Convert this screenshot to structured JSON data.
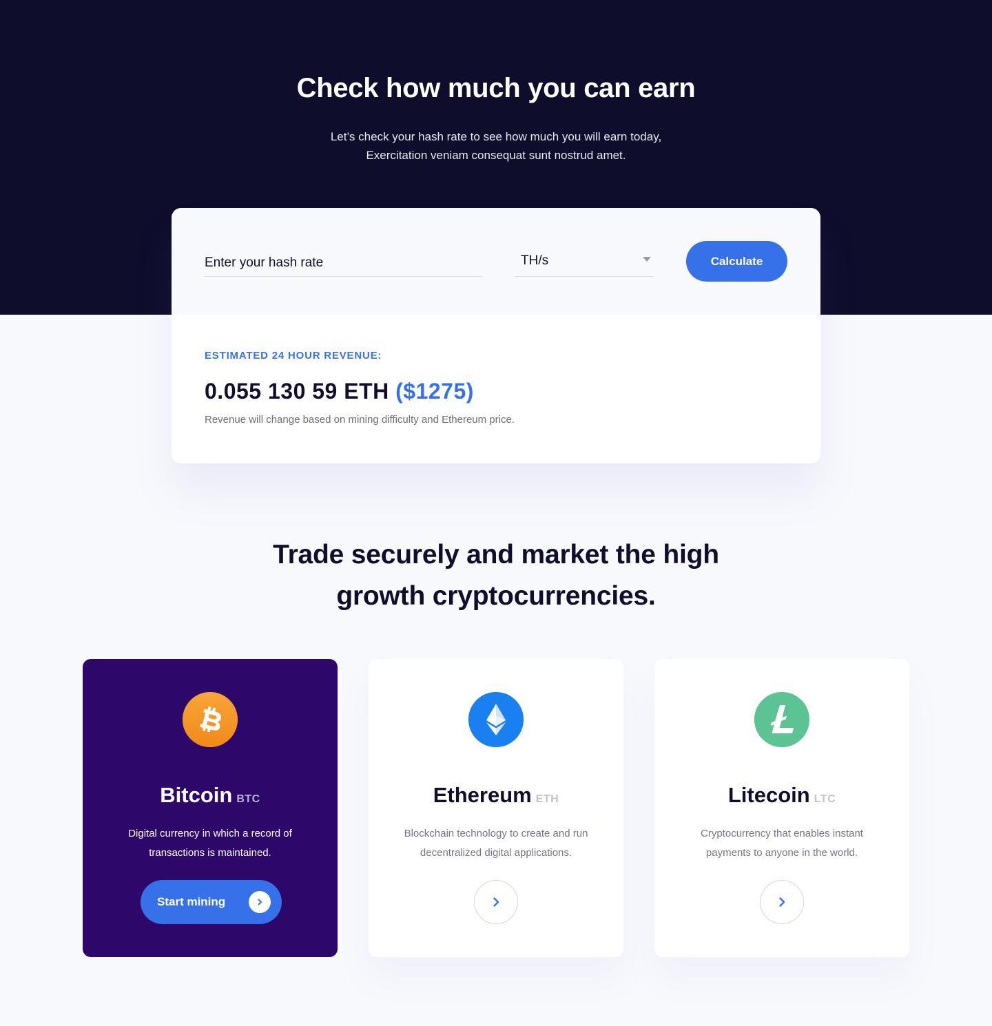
{
  "hero": {
    "title": "Check how much you can earn",
    "subtitle_line1": "Let’s check your hash rate to see how much you will earn today,",
    "subtitle_line2": "Exercitation veniam consequat sunt nostrud amet."
  },
  "calculator": {
    "hash_input_placeholder": "Enter your hash rate",
    "unit_selected": "TH/s",
    "calculate_label": "Calculate",
    "revenue_label": "ESTIMATED 24 HOUR REVENUE:",
    "revenue_eth": "0.055 130 59 ETH",
    "revenue_usd": "($1275)",
    "revenue_note": "Revenue will change based on mining difficulty and Ethereum price."
  },
  "section": {
    "title_line1": "Trade securely and market the high",
    "title_line2": "growth cryptocurrencies."
  },
  "coins": [
    {
      "name": "Bitcoin",
      "ticker": "BTC",
      "desc_line1": "Digital currency in which a record of",
      "desc_line2": "transactions is maintained.",
      "icon": "bitcoin-icon",
      "color": "#f7931a",
      "button_label": "Start mining"
    },
    {
      "name": "Ethereum",
      "ticker": "ETH",
      "desc_line1": "Blockchain technology to create and run",
      "desc_line2": "decentralized digital applications.",
      "icon": "ethereum-icon",
      "color": "#1a7ff0"
    },
    {
      "name": "Litecoin",
      "ticker": "LTC",
      "desc_line1": "Cryptocurrency that enables instant",
      "desc_line2": "payments to anyone in the world.",
      "icon": "litecoin-icon",
      "color": "#5cc494"
    }
  ],
  "colors": {
    "hero_bg": "#0e0d2c",
    "accent": "#3671e9",
    "featured_card_bg": "#2d076a"
  }
}
